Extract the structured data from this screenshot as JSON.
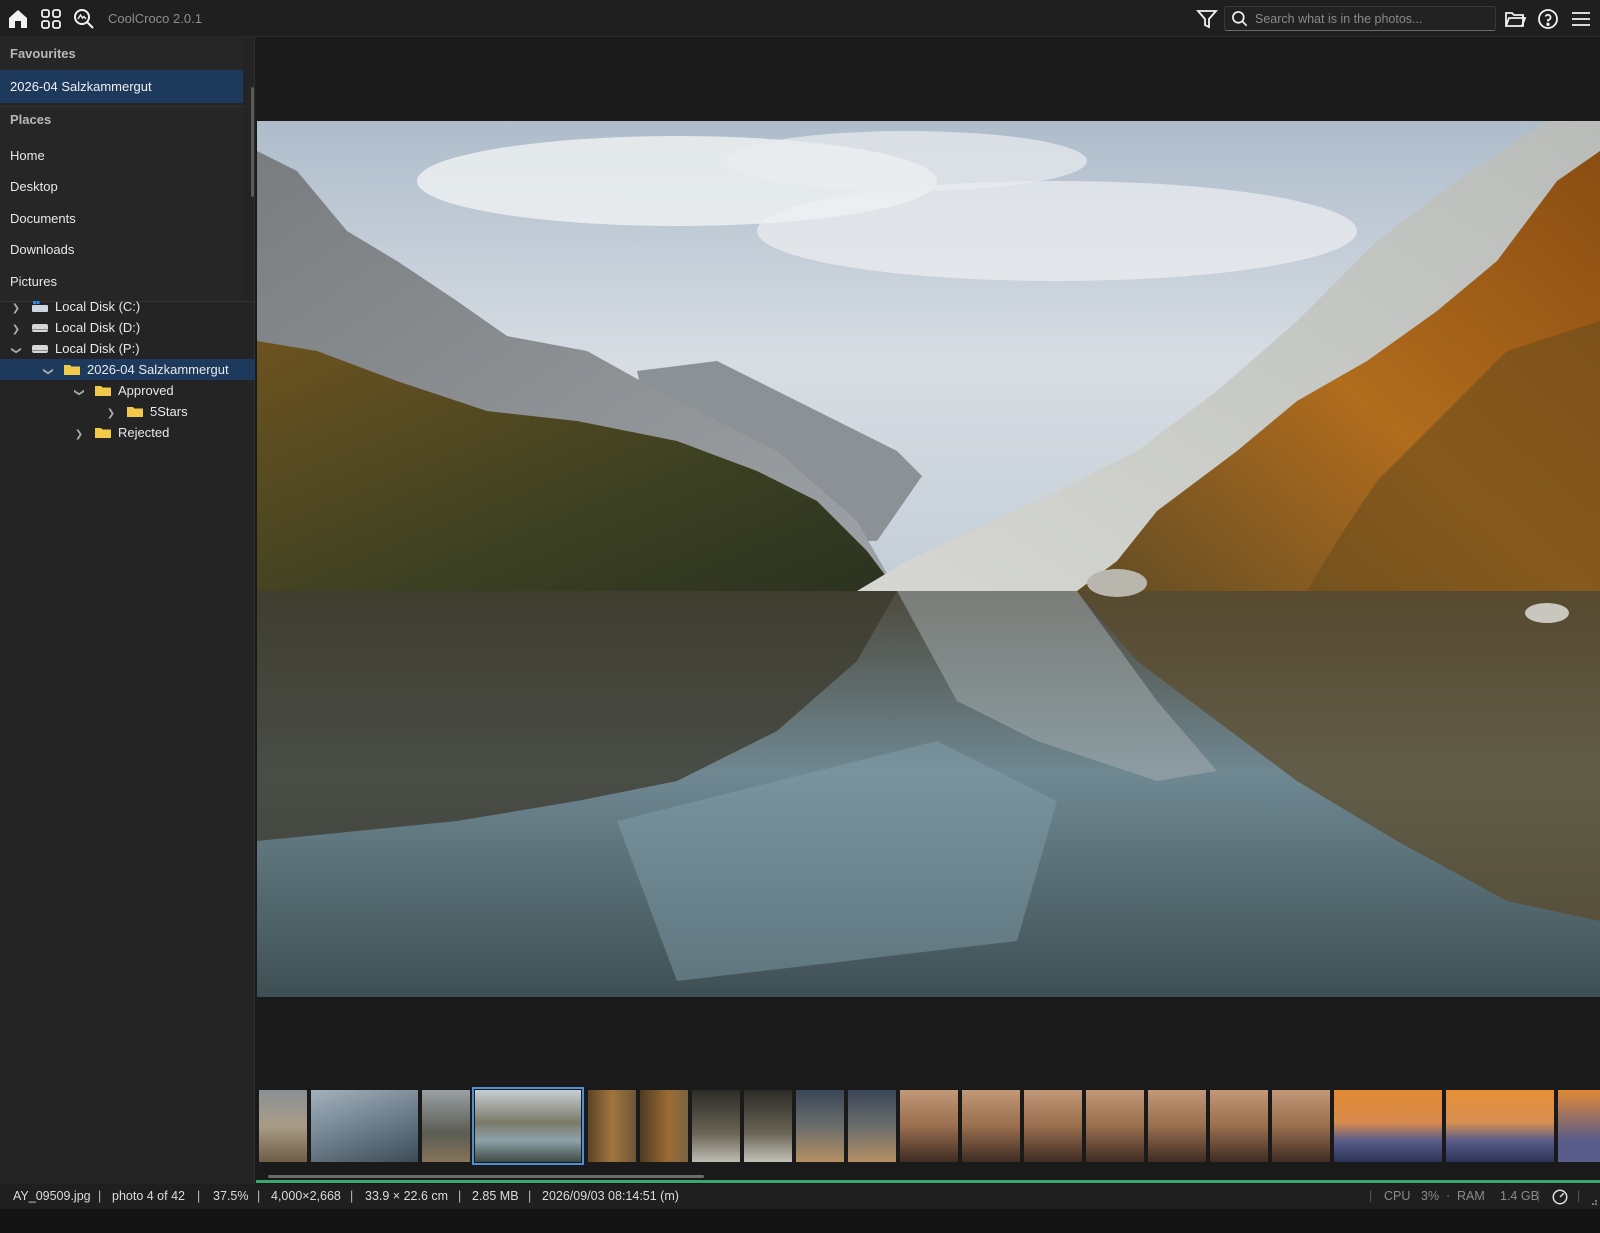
{
  "app": {
    "title": "CoolCroco 2.0.1"
  },
  "toolbar": {
    "search_placeholder": "Search what is in the photos...",
    "icons": [
      "home-icon",
      "grid-icon",
      "zoom-search-icon",
      "filter-icon",
      "search-icon",
      "open-folder-icon",
      "help-icon",
      "menu-icon"
    ]
  },
  "sidebar": {
    "favourites_heading": "Favourites",
    "favourites": [
      "2026-04 Salzkammergut"
    ],
    "places_heading": "Places",
    "places": [
      "Home",
      "Desktop",
      "Documents",
      "Downloads",
      "Pictures"
    ],
    "tree": [
      {
        "label": "Local Disk (C:)",
        "expanded": false,
        "icon": "windows-drive-icon"
      },
      {
        "label": "Local Disk (D:)",
        "expanded": false,
        "icon": "drive-icon"
      },
      {
        "label": "Local Disk (P:)",
        "expanded": true,
        "icon": "drive-icon"
      },
      {
        "label": "2026-04 Salzkammergut",
        "expanded": true,
        "icon": "folder-icon",
        "selected": true
      },
      {
        "label": "Approved",
        "expanded": true,
        "icon": "folder-icon"
      },
      {
        "label": "5Stars",
        "expanded": false,
        "icon": "folder-icon"
      },
      {
        "label": "Rejected",
        "expanded": false,
        "icon": "folder-icon"
      }
    ]
  },
  "viewer": {
    "description_icon": "photo-icon"
  },
  "filmstrip": {
    "count": 20,
    "selected_index": 3
  },
  "status": {
    "filename": "AY_09509.jpg",
    "position": "photo 4 of 42",
    "zoom": "37.5%",
    "dimensions": "4,000×2,668",
    "print_size": "33.9 × 22.6 cm",
    "file_size": "2.85 MB",
    "date": "2026/09/03 08:14:51 (m)",
    "cpu_label": "CPU",
    "cpu_value": "3%",
    "ram_label": "RAM",
    "ram_value": "1.4 GB"
  },
  "colors": {
    "accent": "#1d3a5c",
    "selection_outline": "#4f8fd6",
    "progress": "#3aa76d",
    "folder": "#f2c84b"
  }
}
